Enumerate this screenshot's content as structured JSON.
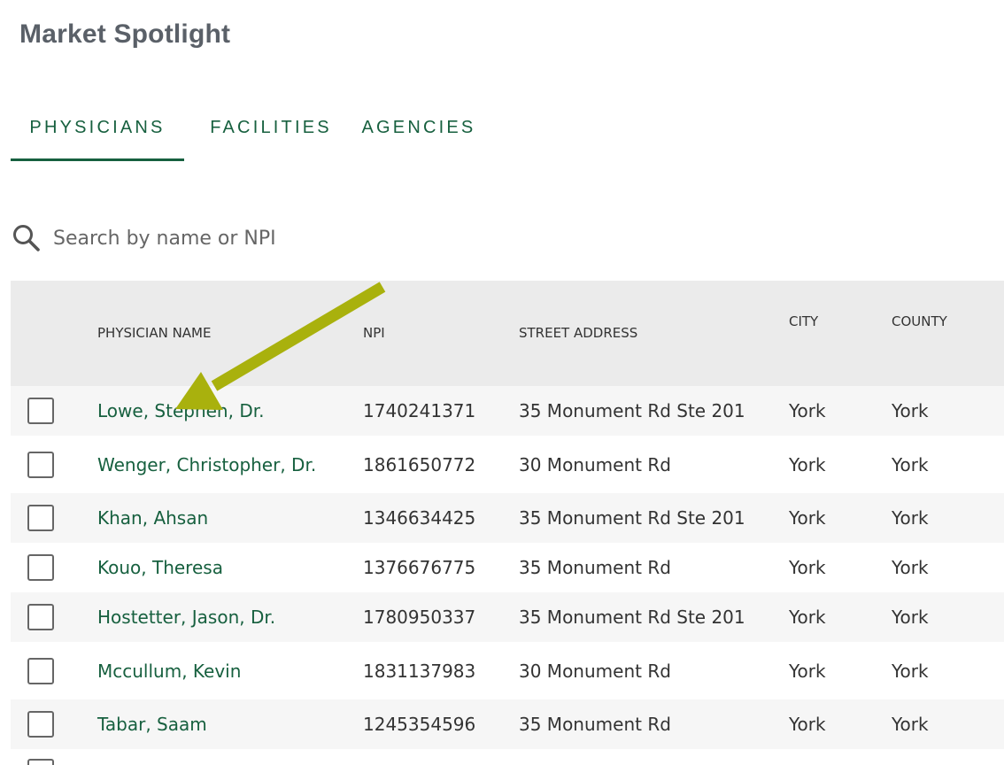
{
  "header": {
    "title": "Market Spotlight"
  },
  "tabs": [
    {
      "label": "PHYSICIANS",
      "active": true
    },
    {
      "label": "FACILITIES",
      "active": false
    },
    {
      "label": "AGENCIES",
      "active": false
    }
  ],
  "search": {
    "placeholder": "Search by name or NPI",
    "value": "",
    "icon": "search-icon"
  },
  "table": {
    "columns": [
      "PHYSICIAN NAME",
      "NPI",
      "STREET ADDRESS",
      "CITY",
      "COUNTY"
    ],
    "rows": [
      {
        "name": "Lowe, Stephen, Dr.",
        "npi": "1740241371",
        "address": "35 Monument Rd Ste 201",
        "city": "York",
        "county": "York",
        "checked": false
      },
      {
        "name": "Wenger, Christopher, Dr.",
        "npi": "1861650772",
        "address": "30 Monument Rd",
        "city": "York",
        "county": "York",
        "checked": false
      },
      {
        "name": "Khan, Ahsan",
        "npi": "1346634425",
        "address": "35 Monument Rd Ste 201",
        "city": "York",
        "county": "York",
        "checked": false
      },
      {
        "name": "Kouo, Theresa",
        "npi": "1376676775",
        "address": "35 Monument Rd",
        "city": "York",
        "county": "York",
        "checked": false
      },
      {
        "name": "Hostetter, Jason, Dr.",
        "npi": "1780950337",
        "address": "35 Monument Rd Ste 201",
        "city": "York",
        "county": "York",
        "checked": false
      },
      {
        "name": "Mccullum, Kevin",
        "npi": "1831137983",
        "address": "30 Monument Rd",
        "city": "York",
        "county": "York",
        "checked": false
      },
      {
        "name": "Tabar, Saam",
        "npi": "1245354596",
        "address": "35 Monument Rd",
        "city": "York",
        "county": "York",
        "checked": false
      }
    ]
  },
  "colors": {
    "brand_green": "#17603f",
    "annotation_arrow": "#a9b10d",
    "header_bg": "#ebebeb",
    "stripe_bg": "#f6f6f6"
  }
}
